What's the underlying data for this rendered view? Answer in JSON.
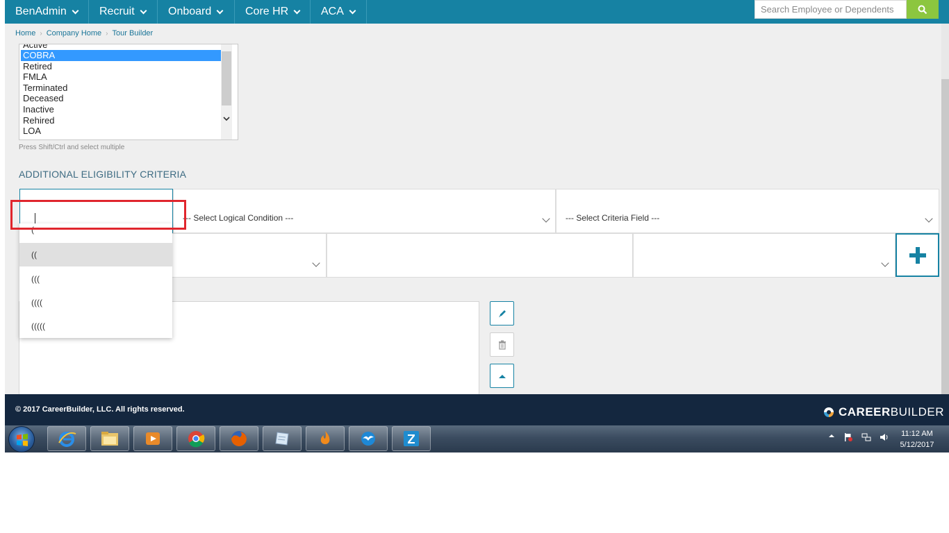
{
  "nav": {
    "items": [
      "BenAdmin",
      "Recruit",
      "Onboard",
      "Core HR",
      "ACA"
    ],
    "search_placeholder": "Search Employee or Dependents"
  },
  "breadcrumb": [
    "Home",
    "Company Home",
    "Tour Builder"
  ],
  "status_list": {
    "items": [
      "Active",
      "COBRA",
      "Retired",
      "FMLA",
      "Terminated",
      "Deceased",
      "Inactive",
      "Rehired",
      "LOA"
    ],
    "selected": "COBRA",
    "help": "Press Shift/Ctrl and select multiple"
  },
  "criteria": {
    "title": "ADDITIONAL ELIGIBILITY CRITERIA",
    "logical_placeholder": "--- Select Logical Condition ---",
    "field_placeholder": "--- Select Criteria Field ---",
    "paren_options": [
      "(",
      "((",
      "(((",
      "((((",
      "((((("
    ],
    "hovered_option": "(("
  },
  "footer": {
    "copyright": "© 2017 CareerBuilder, LLC. All rights reserved.",
    "brand_bold": "CAREER",
    "brand_light": "BUILDER"
  },
  "taskbar": {
    "time": "11:12 AM",
    "date": "5/12/2017"
  },
  "colors": {
    "nav_bg": "#1682a3",
    "search_btn": "#8cc63f",
    "footer_bg": "#14273f",
    "highlight": "#e0262d"
  }
}
